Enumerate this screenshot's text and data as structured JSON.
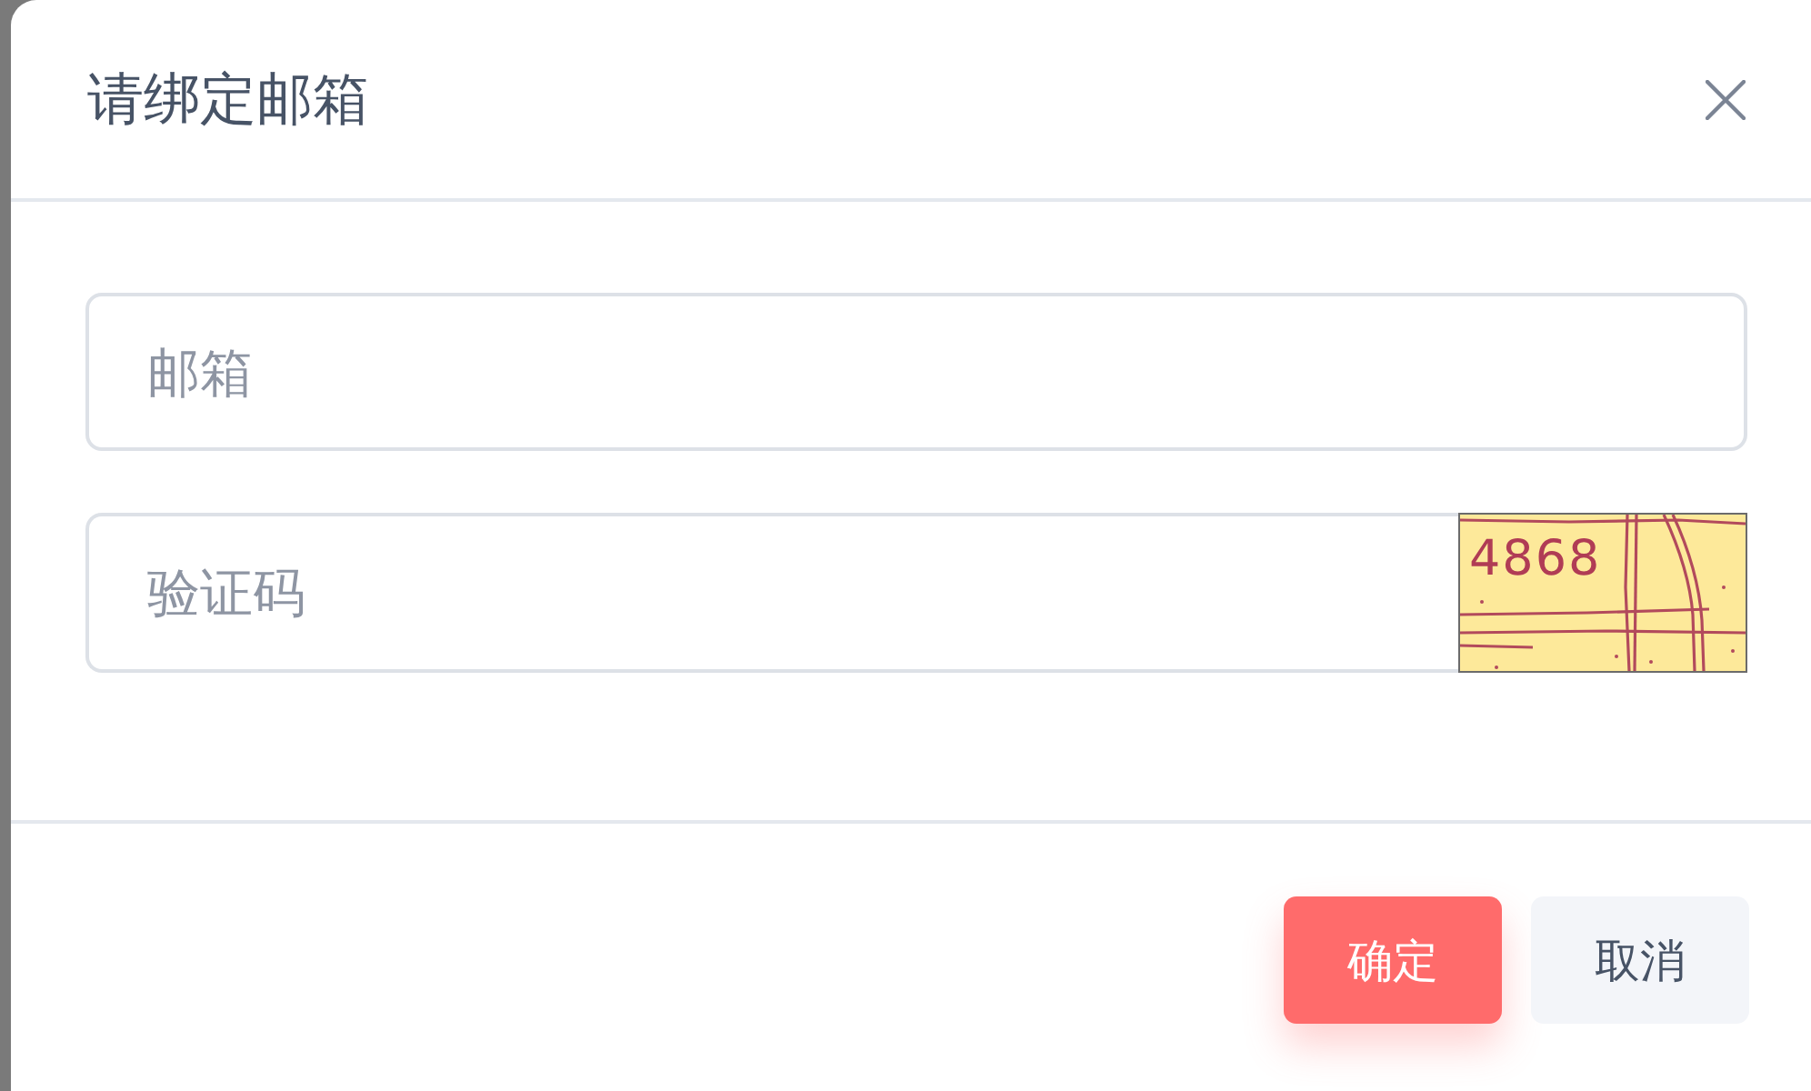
{
  "dialog": {
    "title": "请绑定邮箱"
  },
  "fields": [
    {
      "kind": "text",
      "placeholder": "邮箱"
    },
    {
      "kind": "captcha",
      "placeholder": "验证码",
      "captcha_code": "4868"
    }
  ],
  "buttons": [
    {
      "kind": "primary",
      "label": "确定"
    },
    {
      "kind": "secondary",
      "label": "取消"
    }
  ]
}
